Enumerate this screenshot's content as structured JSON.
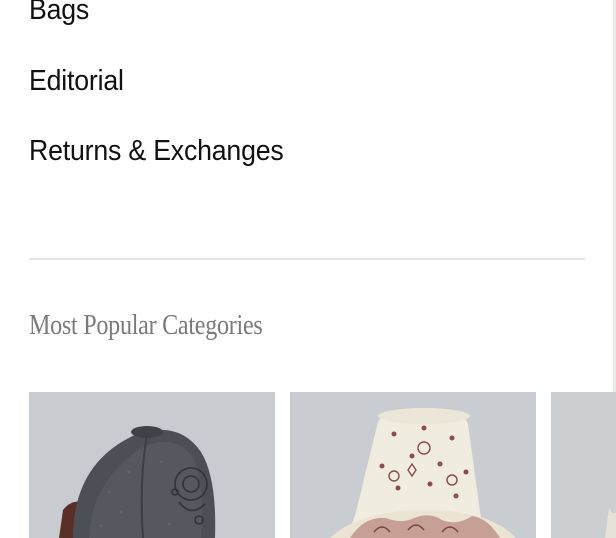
{
  "menu": {
    "items": [
      {
        "label": "Bags"
      },
      {
        "label": "Editorial"
      },
      {
        "label": "Returns & Exchanges"
      }
    ]
  },
  "popular": {
    "title": "Most Popular Categories",
    "cards": [
      {
        "image": "dark-gray-denim-baseball-cap",
        "background": "#c8ccd0"
      },
      {
        "image": "cream-bandana-print-bucket-hat",
        "background": "#c9cdd1"
      },
      {
        "image": "hat-product-photo-partial",
        "background": "#cbcfd2"
      }
    ]
  },
  "colors": {
    "text": "#111111",
    "muted_heading": "#7a7a7a",
    "divider": "#e4e4e4",
    "edge_strip": "#e7ece7"
  }
}
